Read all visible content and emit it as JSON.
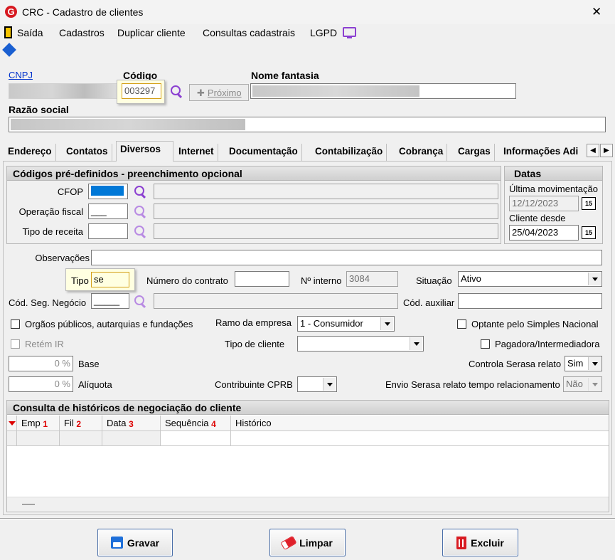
{
  "window": {
    "title": "CRC - Cadastro de clientes",
    "close_glyph": "✕"
  },
  "menu": {
    "saida": "Saída",
    "cadastros": "Cadastros",
    "duplicar": "Duplicar cliente",
    "consultas": "Consultas cadastrais",
    "lgpd": "LGPD"
  },
  "header": {
    "cnpj_label": "CNPJ",
    "codigo_label": "Código",
    "codigo_value": "003297",
    "proximo_label": "Próximo",
    "nome_fantasia_label": "Nome fantasia",
    "razao_social_label": "Razão social"
  },
  "tabs": [
    "Endereço",
    "Contatos",
    "Diversos",
    "Internet",
    "Documentação",
    "Contabilização",
    "Cobrança",
    "Cargas",
    "Informações Adi"
  ],
  "codigos": {
    "title": "Códigos pré-definidos - preenchimento opcional",
    "cfop_label": "CFOP",
    "operacao_label": "Operação fiscal",
    "operacao_value": "___",
    "receita_label": "Tipo de receita"
  },
  "datas": {
    "title": "Datas",
    "ultima_label": "Última movimentação",
    "ultima_value": "12/12/2023",
    "cliente_desde_label": "Cliente desde",
    "cliente_desde_value": "25/04/2023",
    "cal_glyph": "15"
  },
  "diversos": {
    "observacoes_label": "Observações",
    "tipo_label": "Tipo",
    "tipo_value": "se",
    "contrato_label": "Número do contrato",
    "interno_label": "Nº interno",
    "interno_value": "3084",
    "situacao_label": "Situação",
    "situacao_value": "Ativo",
    "seg_negocio_label": "Cód. Seg. Negócio",
    "seg_negocio_value": "_____",
    "cod_auxiliar_label": "Cód. auxiliar",
    "orgaos_label": "Orgãos públicos, autarquias e fundações",
    "ramo_label": "Ramo da empresa",
    "ramo_value": "1 - Consumidor",
    "simples_label": "Optante pelo Simples Nacional",
    "retem_label": "Retém IR",
    "tipo_cliente_label": "Tipo de cliente",
    "pagadora_label": "Pagadora/Intermediadora",
    "base_value": "0 %",
    "base_label": "Base",
    "serasa_label": "Controla Serasa relato",
    "serasa_value": "Sim",
    "aliquota_value": "0 %",
    "aliquota_label": "Alíquota",
    "cprb_label": "Contribuinte CPRB",
    "envio_label": "Envio Serasa relato tempo relacionamento",
    "envio_value": "Não"
  },
  "historico": {
    "title": "Consulta de históricos de negociação do cliente",
    "columns": [
      {
        "label": "Emp",
        "sort": "1"
      },
      {
        "label": "Fil",
        "sort": "2"
      },
      {
        "label": "Data",
        "sort": "3"
      },
      {
        "label": "Sequência",
        "sort": "4"
      },
      {
        "label": "Histórico",
        "sort": ""
      }
    ]
  },
  "buttons": {
    "gravar": "Gravar",
    "limpar": "Limpar",
    "excluir": "Excluir"
  },
  "colors": {
    "accent": "#8b3fd1",
    "highlight": "#ffffe1",
    "selection": "#0078d7",
    "link": "#0033cc"
  }
}
